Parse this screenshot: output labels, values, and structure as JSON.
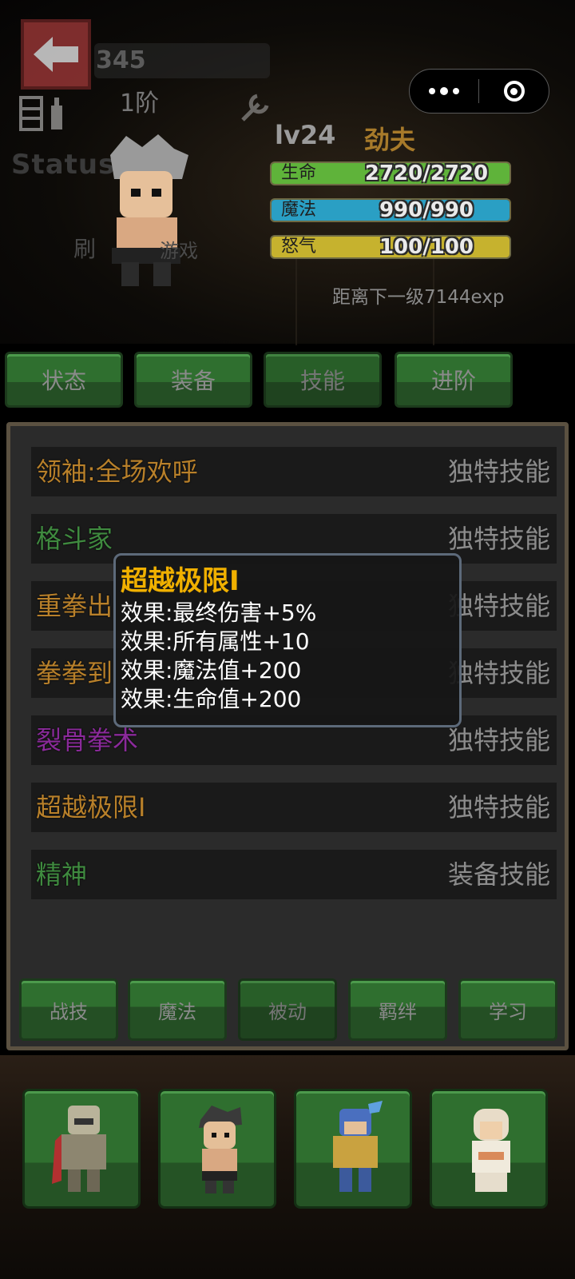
{
  "header": {
    "combat_power": "345",
    "rank": "1阶",
    "status_logo": "Status",
    "overlay_text_left": "刷",
    "overlay_text_right": "游戏"
  },
  "hero": {
    "level": "lv24",
    "job": "劲夫",
    "stats": [
      {
        "label": "生命",
        "value": "2720/2720",
        "fraction": 1.0,
        "color": "#5fb33a"
      },
      {
        "label": "魔法",
        "value": "990/990",
        "fraction": 1.0,
        "color": "#2a9fc4"
      },
      {
        "label": "怒气",
        "value": "100/100",
        "fraction": 1.0,
        "color": "#c6b22e"
      }
    ],
    "exp_next": "距离下一级7144exp"
  },
  "tabs": [
    {
      "label": "状态"
    },
    {
      "label": "装备"
    },
    {
      "label": "技能",
      "active": true
    },
    {
      "label": "进阶"
    }
  ],
  "skills": [
    {
      "name": "领袖:全场欢呼",
      "kind": "独特技能",
      "color": "#b8802a"
    },
    {
      "name": "格斗家",
      "kind": "独特技能",
      "color": "#3f8a3f"
    },
    {
      "name": "重拳出",
      "kind": "独特技能",
      "color": "#b8802a"
    },
    {
      "name": "拳拳到",
      "kind": "独特技能",
      "color": "#b8802a"
    },
    {
      "name": "裂骨拳术",
      "kind": "独特技能",
      "color": "#8a2a9a"
    },
    {
      "name": "超越极限I",
      "kind": "独特技能",
      "color": "#b8802a"
    },
    {
      "name": "精神",
      "kind": "装备技能",
      "color": "#3f8a3f"
    }
  ],
  "tooltip": {
    "title": "超越极限I",
    "lines": [
      "效果:最终伤害+5%",
      "效果:所有属性+10",
      "效果:魔法值+200",
      "效果:生命值+200"
    ]
  },
  "skill_categories": [
    {
      "label": "战技"
    },
    {
      "label": "魔法"
    },
    {
      "label": "被动",
      "active": true
    },
    {
      "label": "羁绊"
    },
    {
      "label": "学习"
    }
  ],
  "party": [
    {
      "icon": "armored-knight-icon"
    },
    {
      "icon": "fighter-icon"
    },
    {
      "icon": "blue-knight-icon"
    },
    {
      "icon": "priestess-icon"
    }
  ]
}
